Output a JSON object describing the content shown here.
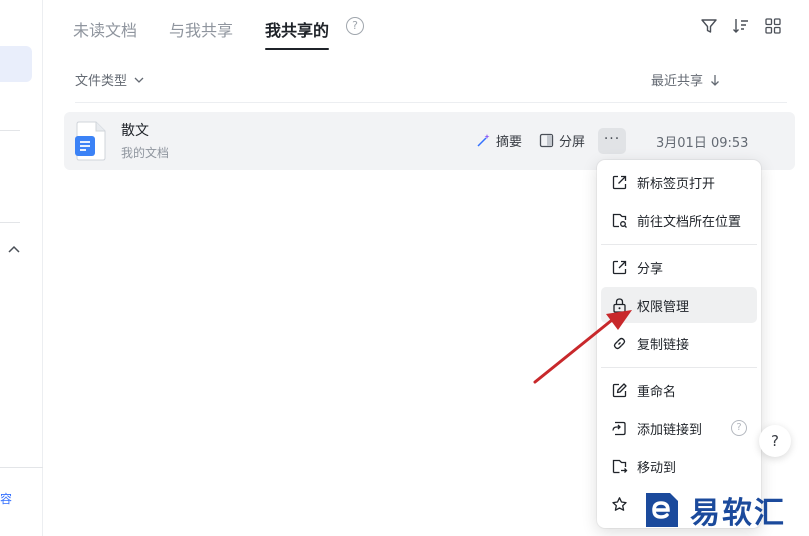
{
  "tabs": [
    {
      "label": "未读文档"
    },
    {
      "label": "与我共享"
    },
    {
      "label": "我共享的",
      "active": true
    }
  ],
  "header": {
    "filter_label": "文件类型",
    "sort_label": "最近共享"
  },
  "file_row": {
    "name": "散文",
    "location": "我的文档",
    "summary_label": "摘要",
    "split_label": "分屏",
    "more_label": "···",
    "date": "3月01日 09:53"
  },
  "menu": {
    "items": [
      {
        "label": "新标签页打开",
        "icon": "new-tab-icon"
      },
      {
        "label": "前往文档所在位置",
        "icon": "locate-folder-icon"
      },
      {
        "label": "分享",
        "icon": "share-icon"
      },
      {
        "label": "权限管理",
        "icon": "lock-icon",
        "hovered": true
      },
      {
        "label": "复制链接",
        "icon": "link-icon"
      },
      {
        "label": "重命名",
        "icon": "rename-icon"
      },
      {
        "label": "添加链接到",
        "icon": "add-link-icon"
      },
      {
        "label": "移动到",
        "icon": "move-icon"
      }
    ],
    "help_mark": "?"
  },
  "sidebar": {
    "partial_label": "容"
  },
  "float_help": "?",
  "tab_help": "?",
  "watermark": {
    "text": "易软汇"
  },
  "colors": {
    "accent": "#3370ff",
    "arrow": "#c8282b",
    "watermark": "#1b4a9c"
  }
}
